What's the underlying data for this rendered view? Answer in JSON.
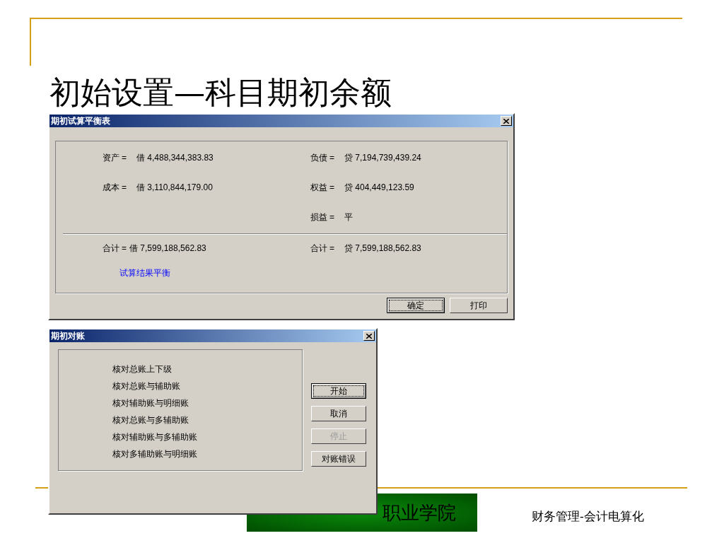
{
  "slide_title": "初始设置—科目期初余额",
  "trial_balance_dialog": {
    "title": "期初试算平衡表",
    "left": [
      {
        "label": "资产 =",
        "value": "借 4,488,344,383.83"
      },
      {
        "label": "成本 =",
        "value": "借 3,110,844,179.00"
      }
    ],
    "right": [
      {
        "label": "负债 =",
        "value": "贷 7,194,739,439.24"
      },
      {
        "label": "权益 =",
        "value": "贷 404,449,123.59"
      },
      {
        "label": "损益 =",
        "value": "平"
      }
    ],
    "total_left": {
      "label": "合计 =",
      "value": "借 7,599,188,562.83"
    },
    "total_right": {
      "label": "合计 =",
      "value": "贷 7,599,188,562.83"
    },
    "result": "试算结果平衡",
    "buttons": [
      {
        "label": "确定",
        "default": true
      },
      {
        "label": "打印",
        "default": false
      }
    ]
  },
  "reconcile_dialog": {
    "title": "期初对账",
    "items": [
      "核对总账上下级",
      "核对总账与辅助账",
      "核对辅助账与明细账",
      "核对总账与多辅助账",
      "核对辅助账与多辅助账",
      "核对多辅助账与明细账"
    ],
    "buttons": [
      {
        "label": "开始",
        "default": true,
        "disabled": false
      },
      {
        "label": "取消",
        "default": false,
        "disabled": false
      },
      {
        "label": "停止",
        "default": false,
        "disabled": true
      },
      {
        "label": "对账错误",
        "default": false,
        "disabled": false
      }
    ]
  },
  "banner": "职业学院",
  "footer": "财务管理-会计电算化"
}
